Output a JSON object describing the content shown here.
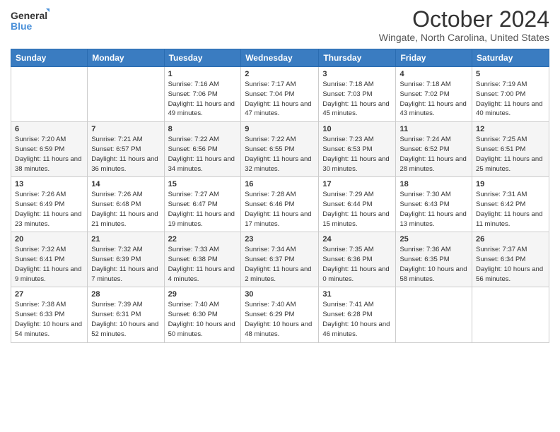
{
  "header": {
    "logo_line1": "General",
    "logo_line2": "Blue",
    "month": "October 2024",
    "location": "Wingate, North Carolina, United States"
  },
  "days_of_week": [
    "Sunday",
    "Monday",
    "Tuesday",
    "Wednesday",
    "Thursday",
    "Friday",
    "Saturday"
  ],
  "weeks": [
    [
      {
        "day": "",
        "sunrise": "",
        "sunset": "",
        "daylight": ""
      },
      {
        "day": "",
        "sunrise": "",
        "sunset": "",
        "daylight": ""
      },
      {
        "day": "1",
        "sunrise": "Sunrise: 7:16 AM",
        "sunset": "Sunset: 7:06 PM",
        "daylight": "Daylight: 11 hours and 49 minutes."
      },
      {
        "day": "2",
        "sunrise": "Sunrise: 7:17 AM",
        "sunset": "Sunset: 7:04 PM",
        "daylight": "Daylight: 11 hours and 47 minutes."
      },
      {
        "day": "3",
        "sunrise": "Sunrise: 7:18 AM",
        "sunset": "Sunset: 7:03 PM",
        "daylight": "Daylight: 11 hours and 45 minutes."
      },
      {
        "day": "4",
        "sunrise": "Sunrise: 7:18 AM",
        "sunset": "Sunset: 7:02 PM",
        "daylight": "Daylight: 11 hours and 43 minutes."
      },
      {
        "day": "5",
        "sunrise": "Sunrise: 7:19 AM",
        "sunset": "Sunset: 7:00 PM",
        "daylight": "Daylight: 11 hours and 40 minutes."
      }
    ],
    [
      {
        "day": "6",
        "sunrise": "Sunrise: 7:20 AM",
        "sunset": "Sunset: 6:59 PM",
        "daylight": "Daylight: 11 hours and 38 minutes."
      },
      {
        "day": "7",
        "sunrise": "Sunrise: 7:21 AM",
        "sunset": "Sunset: 6:57 PM",
        "daylight": "Daylight: 11 hours and 36 minutes."
      },
      {
        "day": "8",
        "sunrise": "Sunrise: 7:22 AM",
        "sunset": "Sunset: 6:56 PM",
        "daylight": "Daylight: 11 hours and 34 minutes."
      },
      {
        "day": "9",
        "sunrise": "Sunrise: 7:22 AM",
        "sunset": "Sunset: 6:55 PM",
        "daylight": "Daylight: 11 hours and 32 minutes."
      },
      {
        "day": "10",
        "sunrise": "Sunrise: 7:23 AM",
        "sunset": "Sunset: 6:53 PM",
        "daylight": "Daylight: 11 hours and 30 minutes."
      },
      {
        "day": "11",
        "sunrise": "Sunrise: 7:24 AM",
        "sunset": "Sunset: 6:52 PM",
        "daylight": "Daylight: 11 hours and 28 minutes."
      },
      {
        "day": "12",
        "sunrise": "Sunrise: 7:25 AM",
        "sunset": "Sunset: 6:51 PM",
        "daylight": "Daylight: 11 hours and 25 minutes."
      }
    ],
    [
      {
        "day": "13",
        "sunrise": "Sunrise: 7:26 AM",
        "sunset": "Sunset: 6:49 PM",
        "daylight": "Daylight: 11 hours and 23 minutes."
      },
      {
        "day": "14",
        "sunrise": "Sunrise: 7:26 AM",
        "sunset": "Sunset: 6:48 PM",
        "daylight": "Daylight: 11 hours and 21 minutes."
      },
      {
        "day": "15",
        "sunrise": "Sunrise: 7:27 AM",
        "sunset": "Sunset: 6:47 PM",
        "daylight": "Daylight: 11 hours and 19 minutes."
      },
      {
        "day": "16",
        "sunrise": "Sunrise: 7:28 AM",
        "sunset": "Sunset: 6:46 PM",
        "daylight": "Daylight: 11 hours and 17 minutes."
      },
      {
        "day": "17",
        "sunrise": "Sunrise: 7:29 AM",
        "sunset": "Sunset: 6:44 PM",
        "daylight": "Daylight: 11 hours and 15 minutes."
      },
      {
        "day": "18",
        "sunrise": "Sunrise: 7:30 AM",
        "sunset": "Sunset: 6:43 PM",
        "daylight": "Daylight: 11 hours and 13 minutes."
      },
      {
        "day": "19",
        "sunrise": "Sunrise: 7:31 AM",
        "sunset": "Sunset: 6:42 PM",
        "daylight": "Daylight: 11 hours and 11 minutes."
      }
    ],
    [
      {
        "day": "20",
        "sunrise": "Sunrise: 7:32 AM",
        "sunset": "Sunset: 6:41 PM",
        "daylight": "Daylight: 11 hours and 9 minutes."
      },
      {
        "day": "21",
        "sunrise": "Sunrise: 7:32 AM",
        "sunset": "Sunset: 6:39 PM",
        "daylight": "Daylight: 11 hours and 7 minutes."
      },
      {
        "day": "22",
        "sunrise": "Sunrise: 7:33 AM",
        "sunset": "Sunset: 6:38 PM",
        "daylight": "Daylight: 11 hours and 4 minutes."
      },
      {
        "day": "23",
        "sunrise": "Sunrise: 7:34 AM",
        "sunset": "Sunset: 6:37 PM",
        "daylight": "Daylight: 11 hours and 2 minutes."
      },
      {
        "day": "24",
        "sunrise": "Sunrise: 7:35 AM",
        "sunset": "Sunset: 6:36 PM",
        "daylight": "Daylight: 11 hours and 0 minutes."
      },
      {
        "day": "25",
        "sunrise": "Sunrise: 7:36 AM",
        "sunset": "Sunset: 6:35 PM",
        "daylight": "Daylight: 10 hours and 58 minutes."
      },
      {
        "day": "26",
        "sunrise": "Sunrise: 7:37 AM",
        "sunset": "Sunset: 6:34 PM",
        "daylight": "Daylight: 10 hours and 56 minutes."
      }
    ],
    [
      {
        "day": "27",
        "sunrise": "Sunrise: 7:38 AM",
        "sunset": "Sunset: 6:33 PM",
        "daylight": "Daylight: 10 hours and 54 minutes."
      },
      {
        "day": "28",
        "sunrise": "Sunrise: 7:39 AM",
        "sunset": "Sunset: 6:31 PM",
        "daylight": "Daylight: 10 hours and 52 minutes."
      },
      {
        "day": "29",
        "sunrise": "Sunrise: 7:40 AM",
        "sunset": "Sunset: 6:30 PM",
        "daylight": "Daylight: 10 hours and 50 minutes."
      },
      {
        "day": "30",
        "sunrise": "Sunrise: 7:40 AM",
        "sunset": "Sunset: 6:29 PM",
        "daylight": "Daylight: 10 hours and 48 minutes."
      },
      {
        "day": "31",
        "sunrise": "Sunrise: 7:41 AM",
        "sunset": "Sunset: 6:28 PM",
        "daylight": "Daylight: 10 hours and 46 minutes."
      },
      {
        "day": "",
        "sunrise": "",
        "sunset": "",
        "daylight": ""
      },
      {
        "day": "",
        "sunrise": "",
        "sunset": "",
        "daylight": ""
      }
    ]
  ]
}
